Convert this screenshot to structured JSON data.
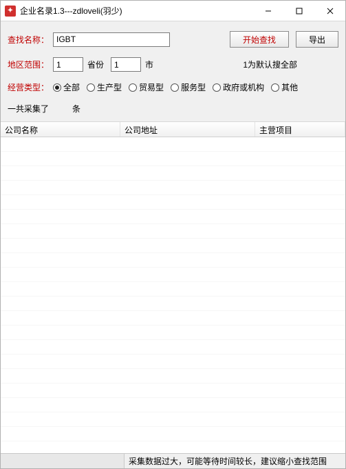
{
  "window": {
    "title": "企业名录1.3---zdloveli(羽少)"
  },
  "form": {
    "search_label": "查找名称：",
    "search_value": "IGBT",
    "start_search_btn": "开始查找",
    "export_btn": "导出",
    "region_label": "地区范围：",
    "province_value": "1",
    "province_suffix": "省份",
    "city_value": "1",
    "city_suffix": "市",
    "region_hint": "1为默认搜全部",
    "type_label": "经营类型：",
    "types": {
      "all": "全部",
      "production": "生产型",
      "trade": "贸易型",
      "service": "服务型",
      "gov": "政府或机构",
      "other": "其他"
    },
    "selected_type": "all",
    "summary_prefix": "一共采集了",
    "summary_suffix": "条"
  },
  "table": {
    "col_company": "公司名称",
    "col_address": "公司地址",
    "col_project": "主营项目"
  },
  "status": {
    "message": "采集数据过大，可能等待时间较长，建议缩小查找范围"
  }
}
